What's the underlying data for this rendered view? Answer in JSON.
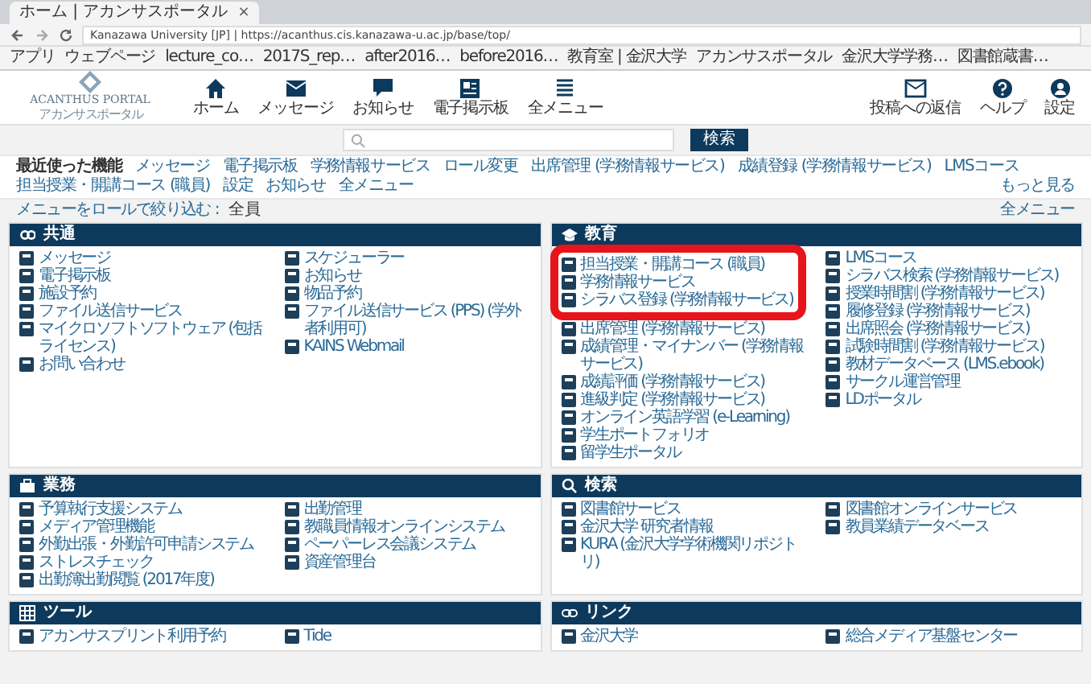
{
  "browser": {
    "tab": "ホーム | アカンサスポータル",
    "tab_close": "×",
    "address": "Kanazawa University [JP] | https://acanthus.cis.kanazawa-u.ac.jp/base/top/",
    "bookmarks": [
      "アプリ",
      "ウェブページ",
      "lecture_co…",
      "2017S_rep…",
      "after2016…",
      "before2016…",
      "教育室 | 金沢大学",
      "アカンサスポータル",
      "金沢大学学務…",
      "図書館蔵書…"
    ]
  },
  "header": {
    "logo": "ACANTHUS PORTAL",
    "logo_sub": "アカンサスポータル",
    "nav": [
      {
        "label": "ホーム"
      },
      {
        "label": "メッセージ"
      },
      {
        "label": "お知らせ"
      },
      {
        "label": "電子掲示板"
      },
      {
        "label": "全メニュー"
      }
    ],
    "tools": [
      {
        "label": "投稿への返信"
      },
      {
        "label": "ヘルプ"
      },
      {
        "label": "設定"
      }
    ]
  },
  "search": {
    "button": "検索"
  },
  "favorites": {
    "title": "最近使った機能",
    "links": [
      "メッセージ",
      "電子掲示板",
      "学務情報サービス",
      "ロール変更",
      "出席管理 (学務情報サービス)",
      "成績登録 (学務情報サービス)",
      "LMSコース",
      "担当授業・開講コース (職員)",
      "設定",
      "お知らせ",
      "全メニュー"
    ],
    "more": "もっと見る"
  },
  "filter": {
    "label": "メニューをロールで絞り込む :",
    "value": "全員",
    "all_menu": "全メニュー"
  },
  "sections": [
    {
      "title": "共通",
      "columns": [
        [
          {
            "label": "メッセージ"
          },
          {
            "label": "電子掲示板"
          },
          {
            "label": "施設予約"
          },
          {
            "label": "ファイル送信サービス"
          },
          {
            "label": "マイクロソフトソフトウェア (包括ライセンス)"
          },
          {
            "label": "お問い合わせ"
          }
        ],
        [
          {
            "label": "スケジューラー"
          },
          {
            "label": "お知らせ"
          },
          {
            "label": "物品予約"
          },
          {
            "label": "ファイル送信サービス (PPS) (学外者利用可)"
          },
          {
            "label": "KAINS Webmail"
          }
        ]
      ]
    },
    {
      "title": "教育",
      "columns": [
        [
          {
            "label": "担当授業・開講コース (職員)",
            "highlighted": true
          },
          {
            "label": "学務情報サービス",
            "highlighted": true
          },
          {
            "label": "シラバス登録 (学務情報サービス)",
            "highlighted": true
          },
          {
            "label": "出席管理 (学務情報サービス)",
            "highlighted": false
          },
          {
            "label": "成績管理・マイナンバー (学務情報サービス)",
            "highlighted": false
          },
          {
            "label": "成績評価 (学務情報サービス)",
            "highlighted": false
          },
          {
            "label": "進級判定 (学務情報サービス)",
            "highlighted": false
          },
          {
            "label": "オンライン英語学習 (e-Learning)",
            "highlighted": false
          },
          {
            "label": "学生ポートフォリオ",
            "highlighted": false
          },
          {
            "label": "留学生ポータル",
            "highlighted": false
          }
        ],
        [
          {
            "label": "LMSコース",
            "highlighted": false
          },
          {
            "label": "シラバス検索 (学務情報サービス)",
            "highlighted": false
          },
          {
            "label": "授業時間割 (学務情報サービス)",
            "highlighted": false
          },
          {
            "label": "履修登録 (学務情報サービス)",
            "highlighted": false
          },
          {
            "label": "出席照会 (学務情報サービス)",
            "highlighted": false
          },
          {
            "label": "試験時間割 (学務情報サービス)",
            "highlighted": false
          },
          {
            "label": "教材データベース (LMS.ebook)",
            "highlighted": false
          },
          {
            "label": "サークル運営管理",
            "highlighted": false
          },
          {
            "label": "LDポータル",
            "highlighted": false
          }
        ]
      ]
    },
    {
      "title": "業務",
      "columns": [
        [
          {
            "label": "予算執行支援システム"
          },
          {
            "label": "メディア管理機能"
          },
          {
            "label": "外勤出張・外勤許可申請システム"
          },
          {
            "label": "ストレスチェック"
          },
          {
            "label": "出勤簿出勤閲覧 (2017年度)"
          }
        ],
        [
          {
            "label": "出勤管理"
          },
          {
            "label": "教職員情報オンラインシステム"
          },
          {
            "label": "ペーパーレス会議システム"
          },
          {
            "label": "資産管理台"
          }
        ]
      ]
    },
    {
      "title": "検索",
      "columns": [
        [
          {
            "label": "図書館サービス"
          },
          {
            "label": "金沢大学 研究者情報"
          },
          {
            "label": "KURA (金沢大学学術機関リポジトリ)"
          }
        ],
        [
          {
            "label": "図書館オンラインサービス"
          },
          {
            "label": "教員業績データベース"
          }
        ]
      ]
    },
    {
      "title": "ツール",
      "columns": [
        [
          {
            "label": "アカンサスプリント利用予約"
          }
        ],
        [
          {
            "label": "Tide"
          }
        ]
      ]
    },
    {
      "title": "リンク",
      "columns": [
        [
          {
            "label": "金沢大学"
          }
        ],
        [
          {
            "label": "総合メディア基盤センター"
          }
        ]
      ]
    }
  ]
}
